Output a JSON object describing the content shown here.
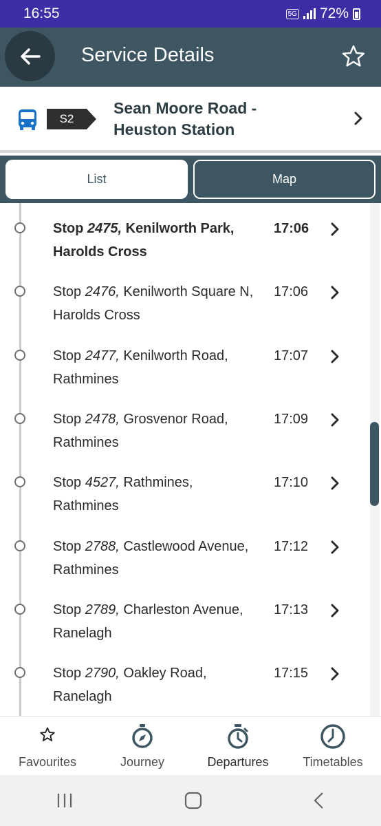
{
  "status_bar": {
    "time": "16:55",
    "network": "5G",
    "battery": "72%"
  },
  "app_bar": {
    "title": "Service Details"
  },
  "route": {
    "number": "S2",
    "name_line1": "Sean Moore Road -",
    "name_line2": "Heuston Station"
  },
  "tabs": [
    {
      "label": "List",
      "selected": true
    },
    {
      "label": "Map",
      "selected": false
    }
  ],
  "stops": [
    {
      "prefix": "Stop ",
      "number": "2475,",
      "line1": " Kenilworth Park,",
      "line2": "Harolds Cross",
      "time": "17:06",
      "current": true
    },
    {
      "prefix": "Stop ",
      "number": "2476,",
      "line1": " Kenilworth Square N,",
      "line2": "Harolds Cross",
      "time": "17:06",
      "current": false
    },
    {
      "prefix": "Stop ",
      "number": "2477,",
      "line1": " Kenilworth Road,",
      "line2": "Rathmines",
      "time": "17:07",
      "current": false
    },
    {
      "prefix": "Stop ",
      "number": "2478,",
      "line1": " Grosvenor Road,",
      "line2": "Rathmines",
      "time": "17:09",
      "current": false
    },
    {
      "prefix": "Stop ",
      "number": "4527,",
      "line1": " Rathmines,",
      "line2": "Rathmines",
      "time": "17:10",
      "current": false
    },
    {
      "prefix": "Stop ",
      "number": "2788,",
      "line1": " Castlewood Avenue,",
      "line2": "Rathmines",
      "time": "17:12",
      "current": false
    },
    {
      "prefix": "Stop ",
      "number": "2789,",
      "line1": " Charleston Avenue,",
      "line2": "Ranelagh",
      "time": "17:13",
      "current": false
    },
    {
      "prefix": "Stop ",
      "number": "2790,",
      "line1": " Oakley Road,",
      "line2": "Ranelagh",
      "time": "17:15",
      "current": false
    }
  ],
  "bottom_nav": [
    {
      "label": "Favourites",
      "icon": "star-outline-icon"
    },
    {
      "label": "Journey",
      "icon": "compass-icon"
    },
    {
      "label": "Departures",
      "icon": "stopwatch-icon",
      "active": true
    },
    {
      "label": "Timetables",
      "icon": "clock-icon"
    }
  ],
  "colors": {
    "primary": "#3e5661",
    "status_bar": "#3c2fa6",
    "bus_icon": "#1a73c8"
  }
}
